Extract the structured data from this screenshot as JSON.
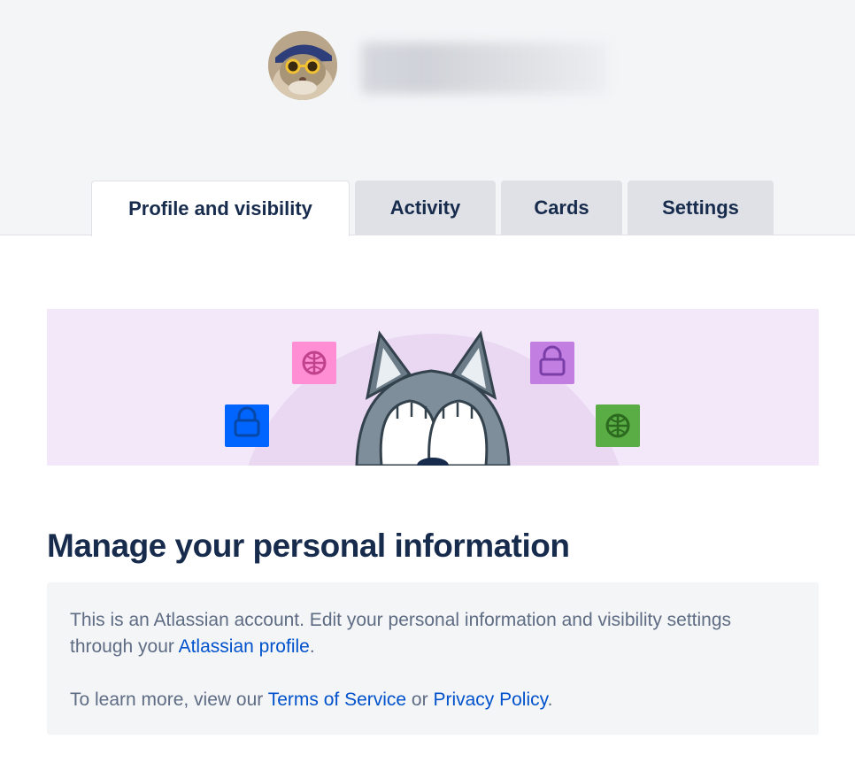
{
  "header": {
    "avatar_alt": "avatar",
    "username": ""
  },
  "tabs": [
    {
      "label": "Profile and visibility",
      "active": true
    },
    {
      "label": "Activity",
      "active": false
    },
    {
      "label": "Cards",
      "active": false
    },
    {
      "label": "Settings",
      "active": false
    }
  ],
  "main": {
    "heading": "Manage your personal information",
    "info": {
      "line1_prefix": "This is an Atlassian account. Edit your personal information and visibility settings through your ",
      "line1_link": "Atlassian profile",
      "line1_suffix": ".",
      "line2_prefix": "To learn more, view our ",
      "terms_link": "Terms of Service",
      "line2_middle": " or ",
      "privacy_link": "Privacy Policy",
      "line2_suffix": "."
    }
  },
  "banner": {
    "icons": [
      "lock-icon",
      "dribbble-icon",
      "lock-icon",
      "dribbble-icon"
    ],
    "colors": {
      "blue": "#0065ff",
      "pink": "#ff8ed4",
      "purple": "#c27ee0",
      "green": "#5aac44"
    }
  },
  "colors": {
    "link": "#0052cc",
    "heading": "#172b4d",
    "body_text": "#5e6c84",
    "header_bg": "#f4f5f7",
    "tab_inactive_bg": "#dfe1e6"
  }
}
